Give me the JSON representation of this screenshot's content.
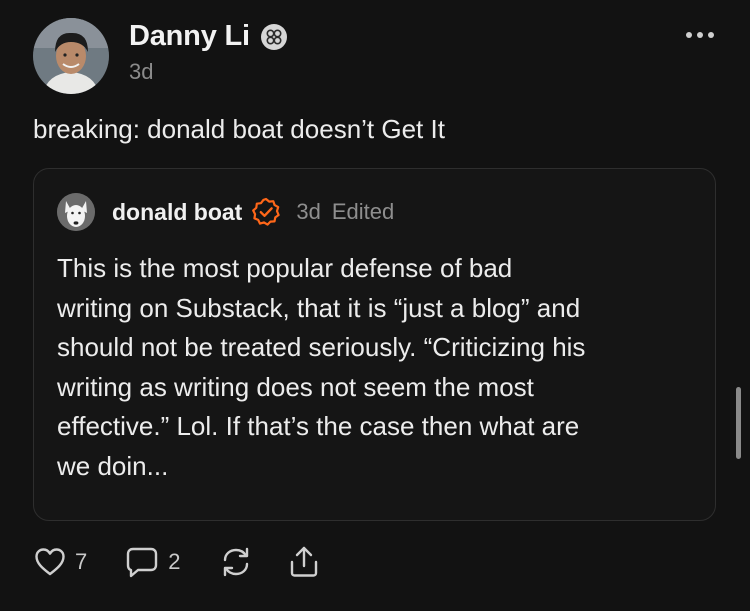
{
  "post": {
    "author": {
      "name": "Danny Li",
      "timestamp": "3d",
      "avatar_icon": "profile-photo",
      "badge_icon": "subscriber-badge-icon"
    },
    "more_icon": "more-horizontal-icon",
    "text": "breaking: donald boat doesn’t Get It"
  },
  "quote": {
    "author": {
      "name": "donald boat",
      "timestamp": "3d",
      "edited_label": "Edited",
      "avatar_icon": "dog-profile-photo",
      "verified_icon": "verified-badge-icon",
      "verified_color": "#ff6719"
    },
    "body_lines": [
      "This is the most popular defense of bad",
      "writing on Substack, that it is “just a blog” and",
      "should not be treated seriously. “Criticizing his",
      "writing as writing does not seem the most",
      "effective.” Lol. If that’s the case then what are",
      "we doin..."
    ]
  },
  "actions": {
    "like": {
      "icon": "heart-icon",
      "count": "7"
    },
    "comment": {
      "icon": "comment-icon",
      "count": "2"
    },
    "restack": {
      "icon": "restack-icon"
    },
    "share": {
      "icon": "share-icon"
    }
  },
  "colors": {
    "background": "#121212",
    "text": "#ececec",
    "muted": "#8b8b8b",
    "accent": "#ff6719"
  }
}
